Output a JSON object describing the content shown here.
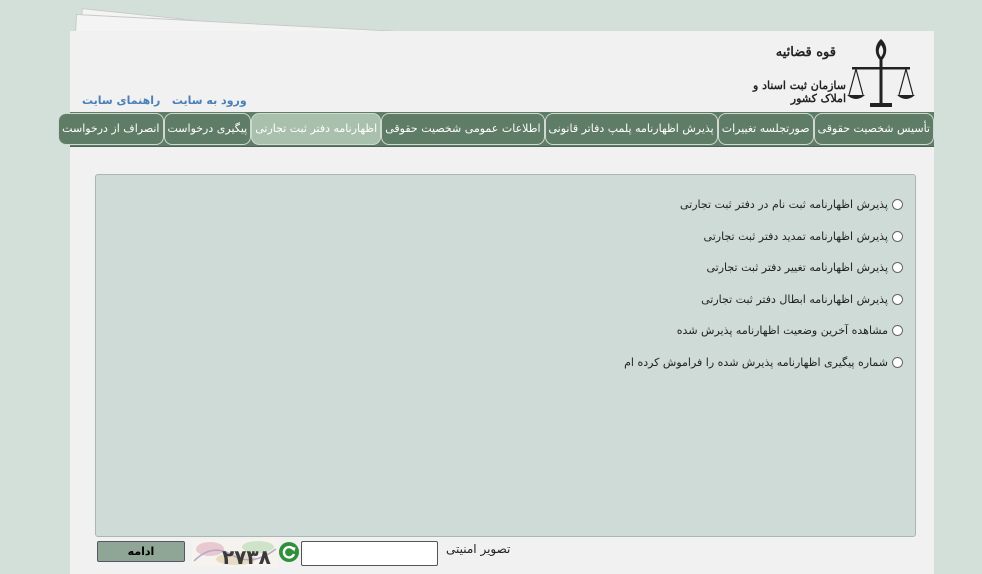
{
  "header": {
    "org_title": "قوه قضائیه",
    "org_subtitle": "سازمان ثبت اسناد و املاک کشور",
    "links": [
      {
        "label": "ورود به سایت"
      },
      {
        "label": "راهنمای سایت"
      }
    ]
  },
  "nav": {
    "tabs": [
      {
        "label": "تأسیس شخصیت حقوقی",
        "active": false
      },
      {
        "label": "صورتجلسه تغییرات",
        "active": false
      },
      {
        "label": "پذیرش اظهارنامه پلمپ دفاتر قانونی",
        "active": false
      },
      {
        "label": "اطلاعات عمومی شخصیت حقوقی",
        "active": false
      },
      {
        "label": "اظهارنامه دفتر ثبت تجارتی",
        "active": true
      },
      {
        "label": "پیگیری درخواست",
        "active": false
      },
      {
        "label": "انصراف از درخواست",
        "active": false
      }
    ]
  },
  "options": [
    {
      "label": "پذیرش اظهارنامه ثبت نام در دفتر ثبت تجارتی"
    },
    {
      "label": "پذیرش اظهارنامه تمدید دفتر ثبت تجارتی"
    },
    {
      "label": "پذیرش اظهارنامه تغییر دفتر ثبت تجارتی"
    },
    {
      "label": "پذیرش اظهارنامه ابطال دفتر ثبت تجارتی"
    },
    {
      "label": "مشاهده آخرین وضعیت اظهارنامه پذیرش شده"
    },
    {
      "label": "شماره پیگیری اظهارنامه پذیرش شده را فراموش کرده ام"
    }
  ],
  "footer": {
    "captcha_label": "تصویر امنیتی",
    "captcha_value": "",
    "captcha_text": "۲۷۳۸",
    "continue_label": "ادامه"
  },
  "colors": {
    "background": "#d3e0da",
    "navbar": "#5f7c66",
    "active_tab": "#a9c0ac",
    "panel": "#cfdbd6",
    "link": "#4a7fb8"
  }
}
